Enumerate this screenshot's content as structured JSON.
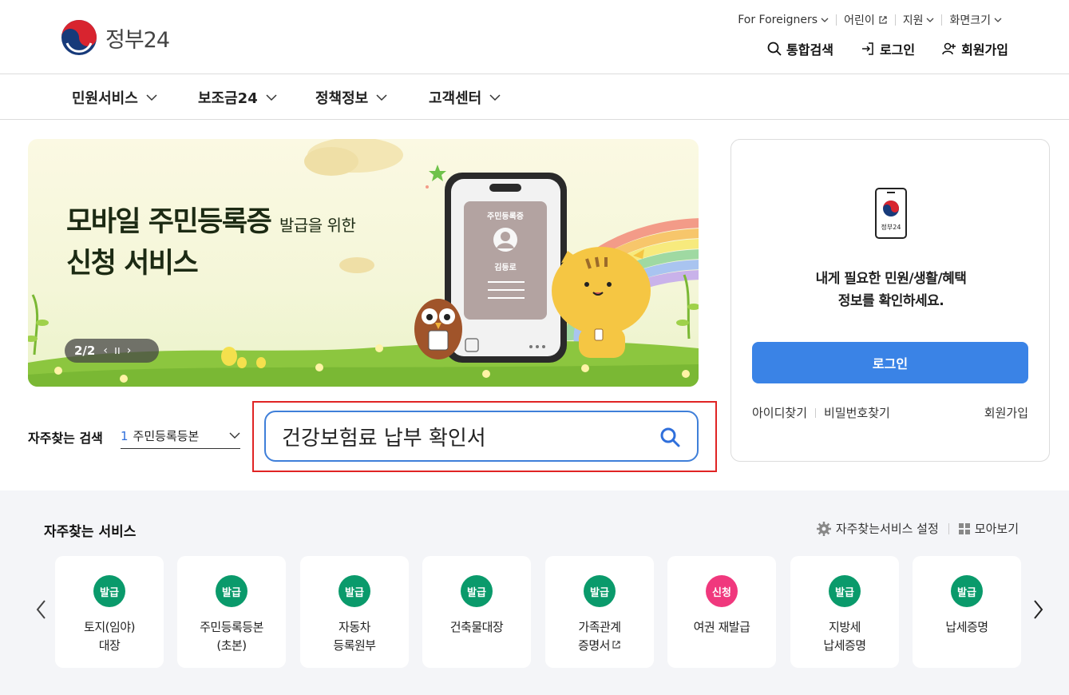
{
  "brand": {
    "logo_text": "정부24"
  },
  "util_links": {
    "foreigners": "For Foreigners",
    "kids": "어린이",
    "support": "지원",
    "screen_size": "화면크기"
  },
  "actions": {
    "search": "통합검색",
    "login": "로그인",
    "signup": "회원가입"
  },
  "nav": [
    "민원서비스",
    "보조금24",
    "정책정보",
    "고객센터"
  ],
  "banner": {
    "title_line1_big": "모바일 주민등록증",
    "title_line1_small": "발급을 위한",
    "title_line2": "신청 서비스",
    "pager": "2/2",
    "card_label": "주민등록증",
    "card_name": "김등로"
  },
  "freq_search": {
    "label": "자주찾는 검색",
    "rank": "1",
    "value": "주민등록등본"
  },
  "search": {
    "value": "건강보험료 납부 확인서"
  },
  "login_card": {
    "phone_label": "정부24",
    "msg_line1": "내게 필요한 민원/생활/혜택",
    "msg_line2": "정보를 확인하세요.",
    "login_button": "로그인",
    "find_id": "아이디찾기",
    "find_pw": "비밀번호찾기",
    "signup": "회원가입"
  },
  "services": {
    "title": "자주찾는 서비스",
    "settings": "자주찾는서비스 설정",
    "view_all": "모아보기",
    "items": [
      {
        "badge": "발급",
        "line1": "토지(임야)",
        "line2": "대장"
      },
      {
        "badge": "발급",
        "line1": "주민등록등본",
        "line2": "(초본)"
      },
      {
        "badge": "발급",
        "line1": "자동차",
        "line2": "등록원부"
      },
      {
        "badge": "발급",
        "line1": "건축물대장",
        "line2": ""
      },
      {
        "badge": "발급",
        "line1": "가족관계",
        "line2": "증명서"
      },
      {
        "badge": "신청",
        "line1": "여권 재발급",
        "line2": ""
      },
      {
        "badge": "발급",
        "line1": "지방세",
        "line2": "납세증명"
      },
      {
        "badge": "발급",
        "line1": "납세증명",
        "line2": ""
      }
    ]
  },
  "colors": {
    "accent": "#3a83e6",
    "issue_badge": "#0a9a6b",
    "apply_badge": "#f0387d",
    "highlight": "#e02424"
  }
}
